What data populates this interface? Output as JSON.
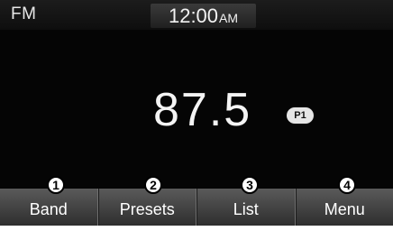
{
  "status_bar": {
    "band": "FM",
    "time": "12:00",
    "ampm": "AM"
  },
  "main": {
    "frequency": "87.5",
    "preset_badge": "P1"
  },
  "buttons": [
    {
      "label": "Band",
      "callout": "1"
    },
    {
      "label": "Presets",
      "callout": "2"
    },
    {
      "label": "List",
      "callout": "3"
    },
    {
      "label": "Menu",
      "callout": "4"
    }
  ]
}
